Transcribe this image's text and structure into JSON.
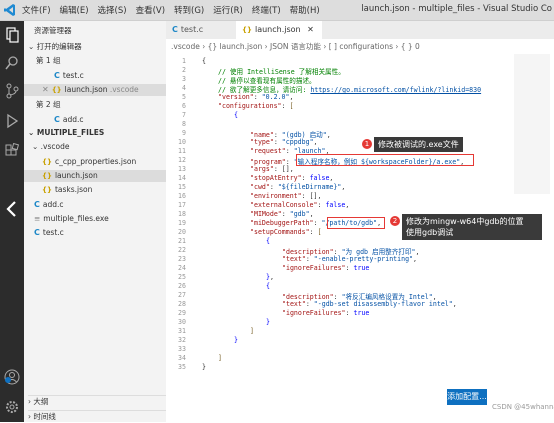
{
  "titlebar": {
    "menu": [
      "文件(F)",
      "编辑(E)",
      "选择(S)",
      "查看(V)",
      "转到(G)",
      "运行(R)",
      "终端(T)",
      "帮助(H)"
    ],
    "window_title": "launch.json - multiple_files - Visual Studio Co"
  },
  "sidebar": {
    "header": "资源管理器",
    "open_editors": "打开的编辑器",
    "group1": "第 1 组",
    "group1_file1": "test.c",
    "group1_file2": "launch.json",
    "group1_file2_path": ".vscode",
    "group2": "第 2 组",
    "group2_file1": "add.c",
    "project": "MULTIPLE_FILES",
    "vscode_folder": ".vscode",
    "f_cpp": "c_cpp_properties.json",
    "f_launch": "launch.json",
    "f_tasks": "tasks.json",
    "f_addc": "add.c",
    "f_exe": "multiple_files.exe",
    "f_testc": "test.c",
    "outline": "大纲",
    "timeline": "时间线"
  },
  "tabs": {
    "tab1": "test.c",
    "tab2": "launch.json"
  },
  "breadcrumb": ".vscode › {} launch.json › JSON 语言功能 › [ ] configurations › { } 0",
  "code": {
    "l2": "// 使用 IntelliSense 了解相关属性。",
    "l3": "// 悬停以查看现有属性的描述。",
    "l4a": "// 欲了解更多信息，请访问: ",
    "l4b": "https://go.microsoft.com/fwlink/?linkid=830",
    "version": "\"0.2.0\"",
    "name": "\"(gdb) 启动\"",
    "type": "\"cppdbg\"",
    "request": "\"launch\"",
    "program": "\"输入程序名称，例如 ${workspaceFolder}/a.exe\"",
    "cwd": "\"${fileDirname}\"",
    "midebugger": "\"/path/to/gdb\"",
    "mimode": "\"gdb\"",
    "desc1": "\"为 gdb 启用整齐打印\"",
    "text1": "\"-enable-pretty-printing\"",
    "desc2": "\"将反汇编风格设置为 Intel\"",
    "text2": "\"-gdb-set disassembly-flavor intel\""
  },
  "annotations": {
    "badge1": "1",
    "callout1": "修改被调试的.exe文件",
    "badge2": "2",
    "callout2_l1": "修改为mingw-w64中gdb的位置",
    "callout2_l2": "使用gdb调试"
  },
  "add_config_button": "添加配置...",
  "watermark": "CSDN @45whanna"
}
